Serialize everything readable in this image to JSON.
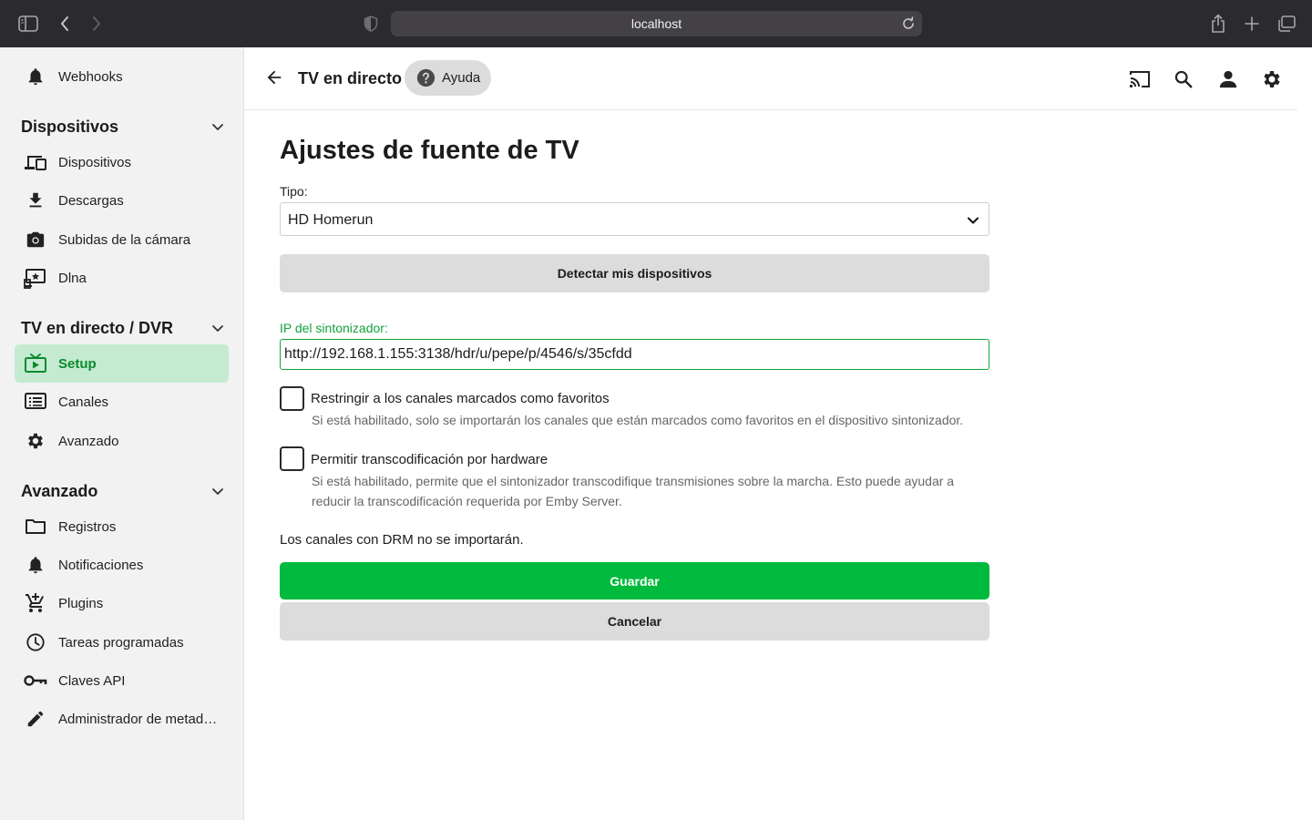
{
  "browser": {
    "url": "localhost",
    "icons": {
      "sidebar_toggle": "sidebar-toggle-icon",
      "back": "chevron-left-icon",
      "forward": "chevron-right-icon",
      "privacy": "shield-icon",
      "reload": "reload-icon",
      "share": "share-icon",
      "new_tab": "plus-icon",
      "tabs": "tabs-overview-icon"
    }
  },
  "sidebar": {
    "top_item": {
      "label": "Webhooks",
      "icon": "bell-icon"
    },
    "sections": [
      {
        "title": "Dispositivos",
        "items": [
          {
            "label": "Dispositivos",
            "icon": "devices-icon"
          },
          {
            "label": "Descargas",
            "icon": "download-icon"
          },
          {
            "label": "Subidas de la cámara",
            "icon": "camera-icon"
          },
          {
            "label": "Dlna",
            "icon": "dlna-icon"
          }
        ]
      },
      {
        "title": "TV en directo / DVR",
        "items": [
          {
            "label": "Setup",
            "icon": "live-tv-icon",
            "active": true
          },
          {
            "label": "Canales",
            "icon": "channels-list-icon"
          },
          {
            "label": "Avanzado",
            "icon": "gear-icon"
          }
        ]
      },
      {
        "title": "Avanzado",
        "items": [
          {
            "label": "Registros",
            "icon": "folder-icon"
          },
          {
            "label": "Notificaciones",
            "icon": "bell-icon"
          },
          {
            "label": "Plugins",
            "icon": "cart-plus-icon"
          },
          {
            "label": "Tareas programadas",
            "icon": "clock-icon"
          },
          {
            "label": "Claves API",
            "icon": "key-icon"
          },
          {
            "label": "Administrador de metadatos",
            "icon": "pencil-icon"
          }
        ]
      }
    ]
  },
  "header": {
    "title": "TV en directo",
    "help_label": "Ayuda"
  },
  "main": {
    "title": "Ajustes de fuente de TV",
    "type_label": "Tipo:",
    "type_value": "HD Homerun",
    "detect_button": "Detectar mis dispositivos",
    "ip_label": "IP del sintonizador:",
    "ip_value": "http://192.168.1.155:3138/hdr/u/pepe/p/4546/s/35cfdd",
    "checkbox_favorites": {
      "label": "Restringir a los canales marcados como favoritos",
      "description": "Si está habilitado, solo se importarán los canales que están marcados como favoritos en el dispositivo sintonizador.",
      "checked": false
    },
    "checkbox_transcoding": {
      "label": "Permitir transcodificación por hardware",
      "description": "Si está habilitado, permite que el sintonizador transcodifique transmisiones sobre la marcha. Esto puede ayudar a reducir la transcodificación requerida por Emby Server.",
      "checked": false
    },
    "drm_note": "Los canales con DRM no se importarán.",
    "save_button": "Guardar",
    "cancel_button": "Cancelar"
  },
  "colors": {
    "accent": "#00ba3d",
    "accent_text": "#0a8a2f",
    "active_bg": "#c4ebd0",
    "sidebar_bg": "#f2f2f3",
    "chrome_bg": "#2b2a2e"
  }
}
